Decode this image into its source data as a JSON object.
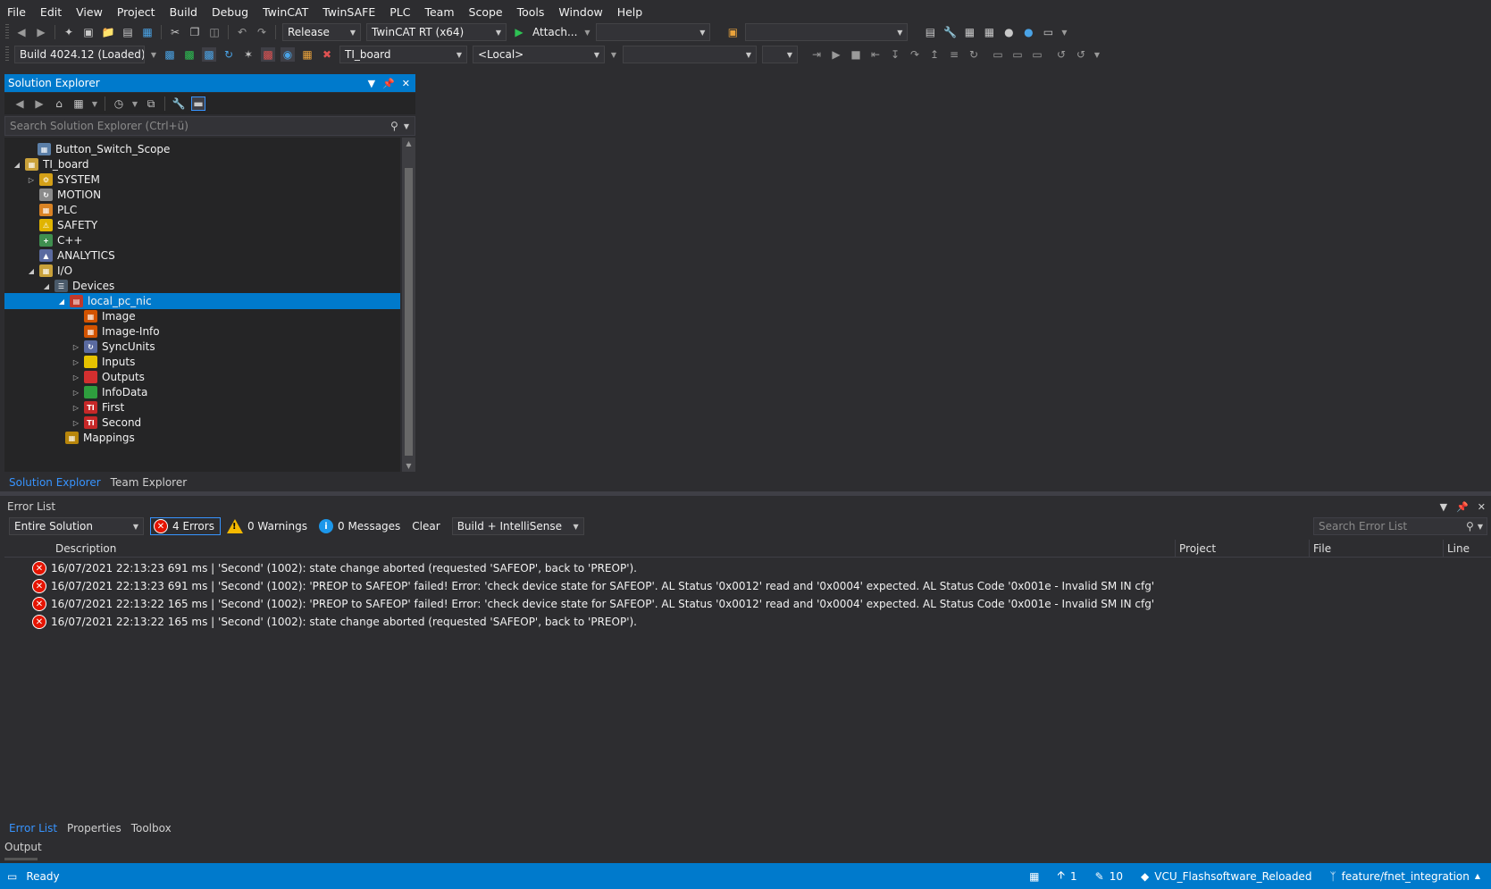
{
  "menu": [
    "File",
    "Edit",
    "View",
    "Project",
    "Build",
    "Debug",
    "TwinCAT",
    "TwinSAFE",
    "PLC",
    "Team",
    "Scope",
    "Tools",
    "Window",
    "Help"
  ],
  "toolbar1": {
    "config": "Release",
    "platform": "TwinCAT RT (x64)",
    "attach_label": "Attach..."
  },
  "toolbar2": {
    "build": "Build 4024.12 (Loaded)",
    "target_project": "TI_board",
    "target_system": "<Local>"
  },
  "solution_explorer": {
    "title": "Solution Explorer",
    "search_placeholder": "Search Solution Explorer (Ctrl+ü)",
    "tree": [
      {
        "label": "Button_Switch_Scope",
        "icon": "solution-icon"
      },
      {
        "label": "TI_board",
        "icon": "twincat-project-icon"
      },
      {
        "label": "SYSTEM",
        "icon": "system-icon"
      },
      {
        "label": "MOTION",
        "icon": "motion-icon"
      },
      {
        "label": "PLC",
        "icon": "plc-icon"
      },
      {
        "label": "SAFETY",
        "icon": "safety-icon"
      },
      {
        "label": "C++",
        "icon": "cpp-icon"
      },
      {
        "label": "ANALYTICS",
        "icon": "analytics-icon"
      },
      {
        "label": "I/O",
        "icon": "io-icon"
      },
      {
        "label": "Devices",
        "icon": "devices-icon"
      },
      {
        "label": "local_pc_nic",
        "icon": "ethercat-master-icon"
      },
      {
        "label": "Image",
        "icon": "image-icon"
      },
      {
        "label": "Image-Info",
        "icon": "image-info-icon"
      },
      {
        "label": "SyncUnits",
        "icon": "syncunits-icon"
      },
      {
        "label": "Inputs",
        "icon": "inputs-icon"
      },
      {
        "label": "Outputs",
        "icon": "outputs-icon"
      },
      {
        "label": "InfoData",
        "icon": "infodata-icon"
      },
      {
        "label": "First",
        "icon": "ti-device-icon"
      },
      {
        "label": "Second",
        "icon": "ti-device-icon"
      },
      {
        "label": "Mappings",
        "icon": "mappings-icon"
      }
    ],
    "tabs": [
      "Solution Explorer",
      "Team Explorer"
    ]
  },
  "error_list": {
    "title": "Error List",
    "scope": "Entire Solution",
    "errors_btn": "4 Errors",
    "warnings_btn": "0 Warnings",
    "messages_btn": "0 Messages",
    "clear_btn": "Clear",
    "source": "Build + IntelliSense",
    "search_placeholder": "Search Error List",
    "columns": {
      "description": "Description",
      "project": "Project",
      "file": "File",
      "line": "Line"
    },
    "rows": [
      "16/07/2021 22:13:23 691 ms | 'Second' (1002): state change aborted (requested 'SAFEOP', back to 'PREOP').",
      "16/07/2021 22:13:23 691 ms | 'Second' (1002): 'PREOP to SAFEOP' failed! Error: 'check device state for SAFEOP'. AL Status '0x0012' read and '0x0004' expected. AL Status Code '0x001e - Invalid SM IN cfg'",
      "16/07/2021 22:13:22 165 ms | 'Second' (1002): 'PREOP to SAFEOP' failed! Error: 'check device state for SAFEOP'. AL Status '0x0012' read and '0x0004' expected. AL Status Code '0x001e - Invalid SM IN cfg'",
      "16/07/2021 22:13:22 165 ms | 'Second' (1002): state change aborted (requested 'SAFEOP', back to 'PREOP')."
    ]
  },
  "panel_tabs": [
    "Error List",
    "Properties",
    "Toolbox"
  ],
  "output_label": "Output",
  "statusbar": {
    "ready": "Ready",
    "up_count": "1",
    "pencil_count": "10",
    "repo": "VCU_Flashsoftware_Reloaded",
    "branch": "feature/fnet_integration"
  },
  "colors": {
    "accent": "#007acc",
    "background": "#2d2d30",
    "panel": "#252526",
    "error": "#e51400",
    "warning": "#f5b900",
    "info": "#1c97ea"
  }
}
